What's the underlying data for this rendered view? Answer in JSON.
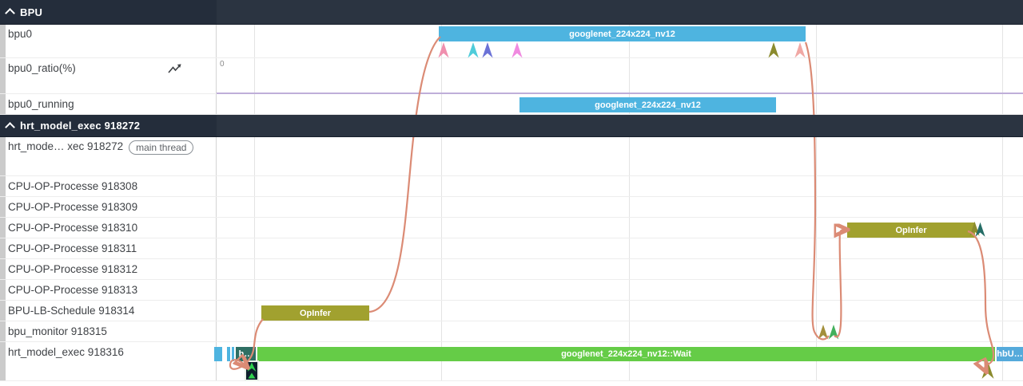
{
  "headers": {
    "bpu": "BPU",
    "hrt": "hrt_model_exec 918272"
  },
  "tracks": {
    "bpu0": "bpu0",
    "ratio": "bpu0_ratio(%)",
    "running": "bpu0_running",
    "main": "hrt_mode… xec 918272",
    "main_badge": "main thread",
    "t08": "CPU-OP-Processe 918308",
    "t09": "CPU-OP-Processe 918309",
    "t10": "CPU-OP-Processe 918310",
    "t11": "CPU-OP-Processe 918311",
    "t12": "CPU-OP-Processe 918312",
    "t13": "CPU-OP-Processe 918313",
    "t14": "BPU-LB-Schedule 918314",
    "t15": "bpu_monitor 918315",
    "t16": "hrt_model_exec 918316"
  },
  "counter": {
    "value": "0"
  },
  "slices": {
    "bpu0": "googlenet_224x224_nv12",
    "running": "googlenet_224x224_nv12",
    "opinfer_cpu": "OpInfer",
    "opinfer_sched": "OpInfer",
    "wait": "googlenet_224x224_nv12::Wait",
    "h": "h…",
    "hbu": "hbU…"
  },
  "colors": {
    "header_bg": "#242d3b",
    "slice_blue": "#4eb4e0",
    "slice_olive": "#a1a12f",
    "slice_green": "#65cc47",
    "slice_dark_teal": "#2e6f63",
    "slice_blue_right": "#55aadb",
    "counter_line": "#bfaed9",
    "flow_line": "#db8b75",
    "arrow_pink": "#ef8fae",
    "arrow_teal": "#4fccda",
    "arrow_indigo": "#6b72d6",
    "arrow_orchid": "#f08ae0",
    "arrow_olive": "#8b8b2e",
    "arrow_salmon": "#f0a8a4",
    "arrow_gold": "#a3903c",
    "arrow_green": "#43b05c",
    "marker_green": "#2fd24e"
  }
}
